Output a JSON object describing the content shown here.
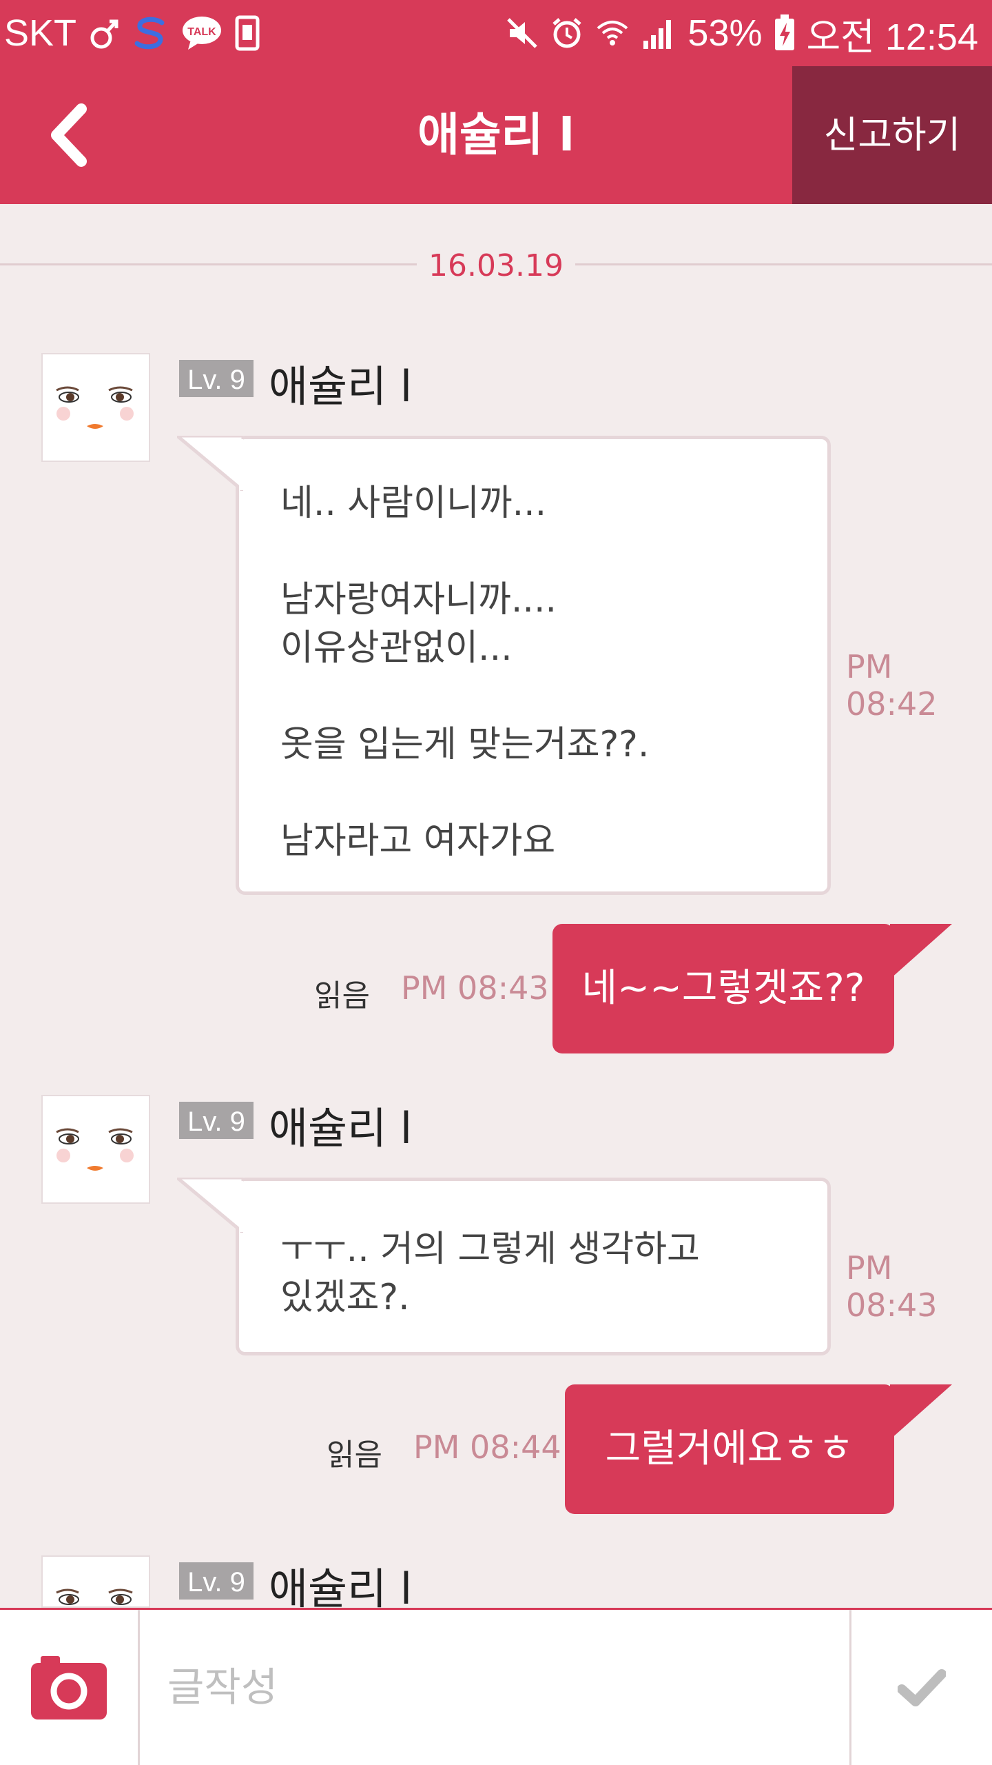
{
  "status_bar": {
    "carrier": "SKT",
    "battery": "53%",
    "time": "오전 12:54",
    "icons_left": [
      "male-symbol-icon",
      "s-app-icon",
      "talk-bubble-icon",
      "sim-icon"
    ],
    "icons_right": [
      "mute-icon",
      "alarm-icon",
      "wifi-icon",
      "signal-icon",
      "battery-charging-icon"
    ]
  },
  "header": {
    "title": "애슐리 l",
    "report_label": "신고하기",
    "back_icon": "chevron-left-icon"
  },
  "colors": {
    "primary": "#d73a58",
    "report_bg": "#882840",
    "background": "#f3ecec",
    "time_color": "#c98a95"
  },
  "date_divider": "16.03.19",
  "messages": [
    {
      "sender_level": "Lv. 9",
      "sender_name": "애슐리 l",
      "text": "네.. 사람이니까...\n\n남자랑여자니까....\n이유상관없이...\n\n옷을 입는게 맞는거죠??.\n\n남자라고 여자가요",
      "time": "PM 08:42"
    },
    {
      "outgoing": true,
      "read_label": "읽음",
      "time": "PM 08:43",
      "text": "네~~그렇겟죠??"
    },
    {
      "sender_level": "Lv. 9",
      "sender_name": "애슐리 l",
      "text": "ㅜㅜ.. 거의 그렇게 생각하고\n있겠죠?.",
      "time": "PM 08:43"
    },
    {
      "outgoing": true,
      "read_label": "읽음",
      "time": "PM 08:44",
      "text": "그럴거에요ㅎㅎ"
    },
    {
      "sender_level": "Lv. 9",
      "sender_name": "애슐리 l"
    }
  ],
  "composer": {
    "placeholder": "글작성",
    "camera_icon": "camera-icon",
    "send_icon": "checkmark-icon"
  }
}
